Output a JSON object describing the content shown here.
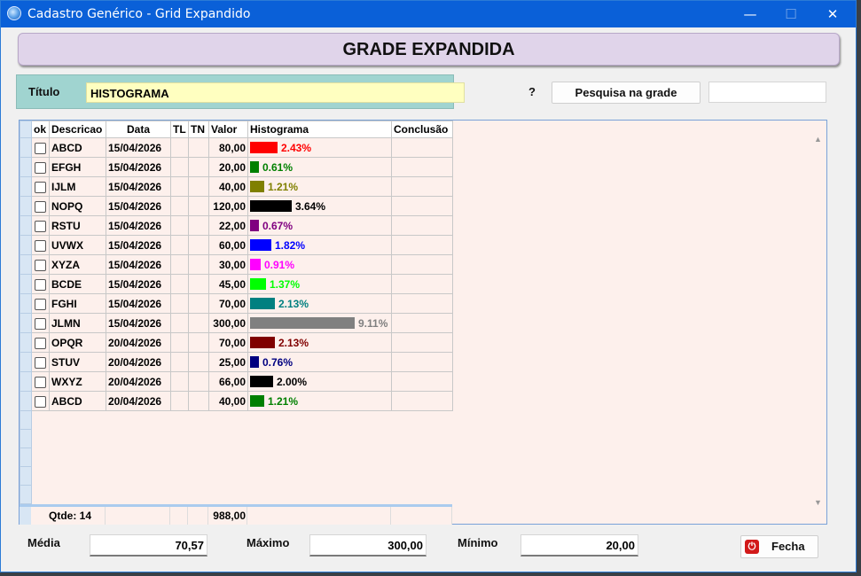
{
  "window": {
    "title": "Cadastro Genérico - Grid Expandido"
  },
  "titlebar_controls": {
    "minimize": "—",
    "maximize": "☐",
    "close": "✕"
  },
  "banner": {
    "text": "GRADE EXPANDIDA"
  },
  "title_field": {
    "label": "Título",
    "value": "HISTOGRAMA"
  },
  "search": {
    "help": "?",
    "button_label": "Pesquisa na grade",
    "value": ""
  },
  "grid": {
    "columns": [
      "ok",
      "Descricao",
      "Data",
      "TL",
      "TN",
      "Valor",
      "Histograma",
      "Conclusão"
    ],
    "rows": [
      {
        "desc": "ABCD",
        "date": "15/04/2026",
        "value": "80,00",
        "pct": "2.43%",
        "color": "#ff0000",
        "frac": 0.0243
      },
      {
        "desc": "EFGH",
        "date": "15/04/2026",
        "value": "20,00",
        "pct": "0.61%",
        "color": "#008000",
        "frac": 0.0061
      },
      {
        "desc": "IJLM",
        "date": "15/04/2026",
        "value": "40,00",
        "pct": "1.21%",
        "color": "#808000",
        "frac": 0.0121
      },
      {
        "desc": "NOPQ",
        "date": "15/04/2026",
        "value": "120,00",
        "pct": "3.64%",
        "color": "#000000",
        "frac": 0.0364
      },
      {
        "desc": "RSTU",
        "date": "15/04/2026",
        "value": "22,00",
        "pct": "0.67%",
        "color": "#800080",
        "frac": 0.0067
      },
      {
        "desc": "UVWX",
        "date": "15/04/2026",
        "value": "60,00",
        "pct": "1.82%",
        "color": "#0000ff",
        "frac": 0.0182
      },
      {
        "desc": "XYZA",
        "date": "15/04/2026",
        "value": "30,00",
        "pct": "0.91%",
        "color": "#ff00ff",
        "frac": 0.0091
      },
      {
        "desc": "BCDE",
        "date": "15/04/2026",
        "value": "45,00",
        "pct": "1.37%",
        "color": "#00ff00",
        "frac": 0.0137
      },
      {
        "desc": "FGHI",
        "date": "15/04/2026",
        "value": "70,00",
        "pct": "2.13%",
        "color": "#008080",
        "frac": 0.0213
      },
      {
        "desc": "JLMN",
        "date": "15/04/2026",
        "value": "300,00",
        "pct": "9.11%",
        "color": "#808080",
        "frac": 0.0911
      },
      {
        "desc": "OPQR",
        "date": "20/04/2026",
        "value": "70,00",
        "pct": "2.13%",
        "color": "#800000",
        "frac": 0.0213
      },
      {
        "desc": "STUV",
        "date": "20/04/2026",
        "value": "25,00",
        "pct": "0.76%",
        "color": "#000080",
        "frac": 0.0076
      },
      {
        "desc": "WXYZ",
        "date": "20/04/2026",
        "value": "66,00",
        "pct": "2.00%",
        "color": "#000000",
        "frac": 0.02
      },
      {
        "desc": "ABCD",
        "date": "20/04/2026",
        "value": "40,00",
        "pct": "1.21%",
        "color": "#008000",
        "frac": 0.0121
      }
    ],
    "footer": {
      "count": "Qtde: 14",
      "total": "988,00"
    }
  },
  "stats": {
    "media_label": "Média",
    "media_value": "70,57",
    "max_label": "Máximo",
    "max_value": "300,00",
    "min_label": "Mínimo",
    "min_value": "20,00"
  },
  "close_button": {
    "label": "Fecha",
    "icon": "power-icon"
  }
}
